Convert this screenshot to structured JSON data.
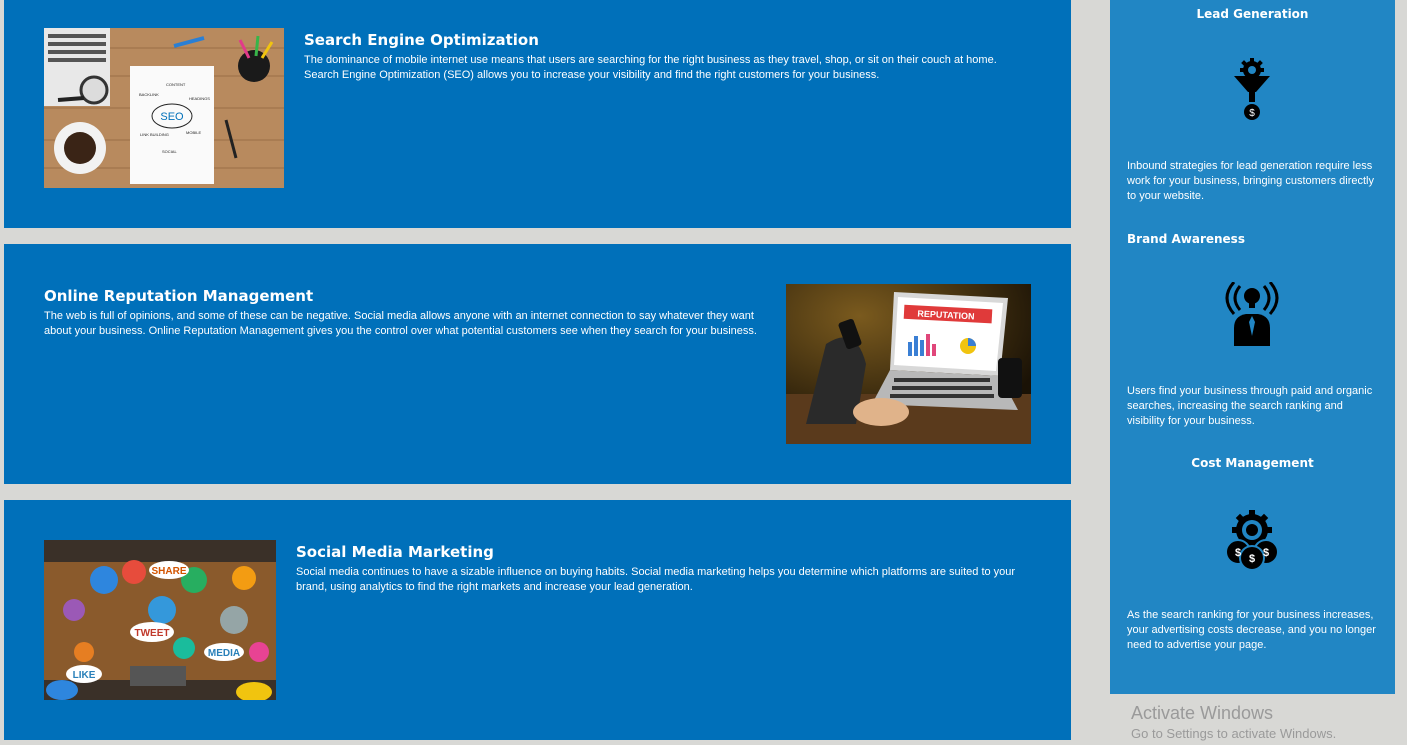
{
  "cards": {
    "seo": {
      "title": "Search Engine Optimization",
      "body": "The dominance of mobile internet use means that users are searching for the right business as they travel, shop, or sit on their couch at home. Search Engine Optimization (SEO) allows you to increase your visibility and find the right customers for your business.",
      "image_text": "SEO"
    },
    "orm": {
      "title": "Online Reputation Management",
      "body": "The web is full of opinions, and some of these can be negative. Social media allows anyone with an internet connection to say whatever they want about your business. Online Reputation Management gives you the control over what potential customers see when they search for your business.",
      "image_text": "REPUTATION"
    },
    "smm": {
      "title": "Social Media Marketing",
      "body": "Social media continues to have a sizable influence on buying habits. Social media marketing helps you determine which platforms are suited to your brand, using analytics to find the right markets and increase your lead generation.",
      "image_words": [
        "SHARE",
        "TWEET",
        "LIKE",
        "MEDIA"
      ]
    }
  },
  "sidebar": {
    "items": [
      {
        "title": "Lead Generation",
        "icon": "funnel-gear-dollar-icon",
        "text": "Inbound strategies for lead generation require less work for your business, bringing customers directly to your website."
      },
      {
        "title": "Brand Awareness",
        "icon": "broadcasting-person-icon",
        "text": "Users find your business through paid and organic searches, increasing the search ranking and visibility for your business."
      },
      {
        "title": "Cost Management",
        "icon": "gear-coins-icon",
        "text": "As the search ranking for your business increases, your advertising costs decrease, and you no longer need to advertise your page."
      }
    ]
  },
  "watermark": {
    "title": "Activate Windows",
    "subtitle": "Go to Settings to activate Windows."
  },
  "colors": {
    "card_bg": "#0070ba",
    "sidebar_bg": "#2186c4",
    "page_bg": "#d8d8d5"
  }
}
